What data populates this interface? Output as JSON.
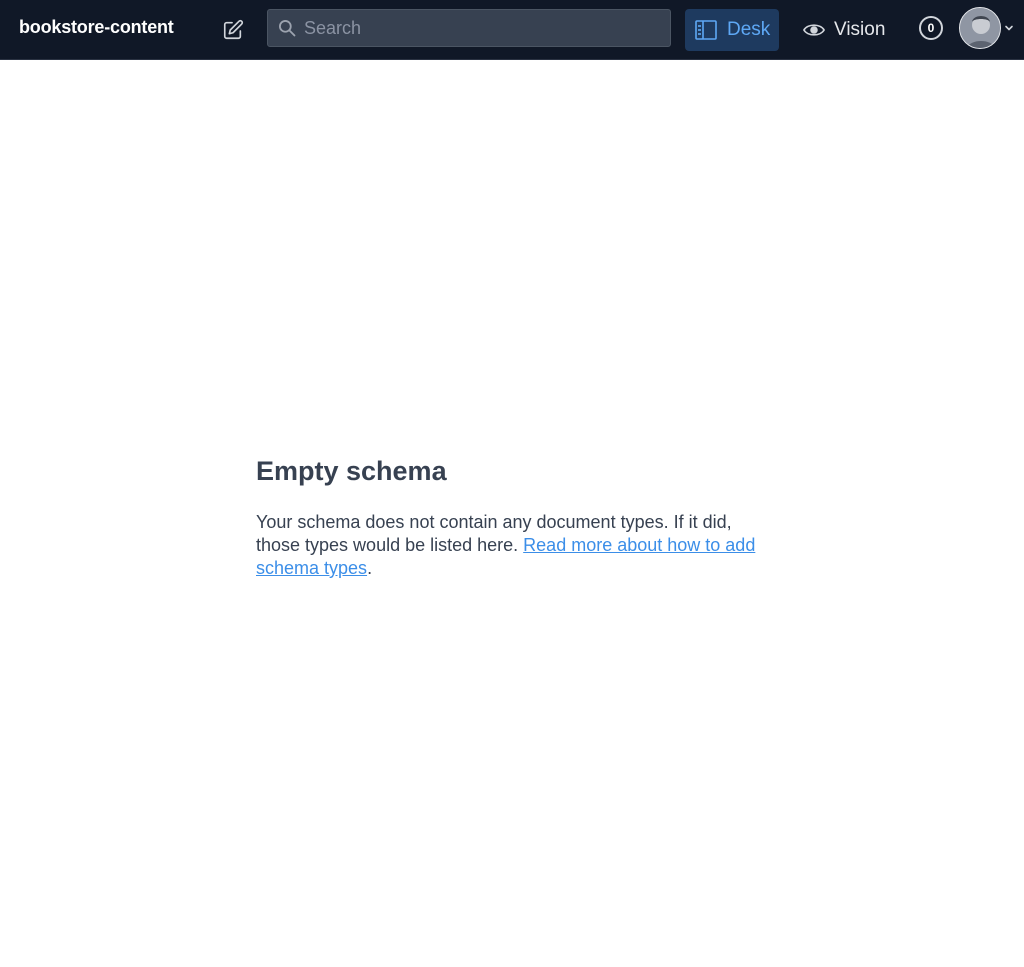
{
  "navbar": {
    "brand": "bookstore-content",
    "search": {
      "placeholder": "Search",
      "value": ""
    },
    "tools": [
      {
        "label": "Desk",
        "icon": "desk-icon",
        "active": true
      },
      {
        "label": "Vision",
        "icon": "eye-icon",
        "active": false
      }
    ],
    "presence_count": "0"
  },
  "main": {
    "title": "Empty schema",
    "text_before_link": "Your schema does not contain any document types. If it did, those types would be listed here. ",
    "link_text": "Read more about how to add schema types",
    "text_after_link": "."
  },
  "colors": {
    "navbar_bg": "#101827",
    "accent": "#3b8ee8",
    "active_tool_bg": "#1e3a5f"
  }
}
